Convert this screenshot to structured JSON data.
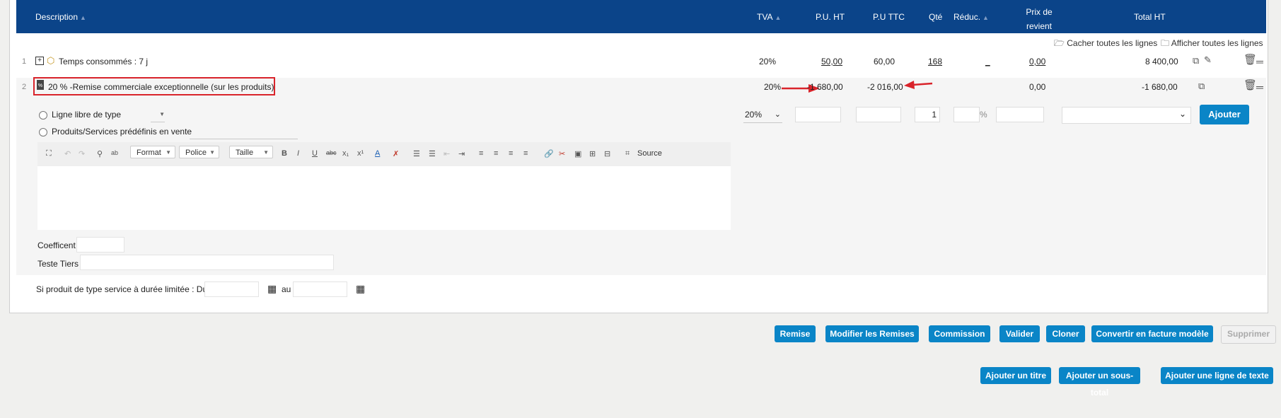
{
  "header": {
    "description": "Description",
    "tva": "TVA",
    "pu_ht": "P.U. HT",
    "pu_ttc": "P.U TTC",
    "qte": "Qté",
    "reduc": "Réduc.",
    "prix_revient_1": "Prix de",
    "prix_revient_2": "revient",
    "total_ht": "Total HT"
  },
  "toggles": {
    "hide_all": "Cacher toutes les lignes",
    "show_all": "Afficher toutes les lignes"
  },
  "lines": [
    {
      "num": "1",
      "label": "Temps consommés : 7 j",
      "tva": "20%",
      "pu_ht": "50,00",
      "pu_ttc": "60,00",
      "qte": "168",
      "reduc": "_",
      "prix_revient": "0,00",
      "total_ht": "8 400,00"
    },
    {
      "num": "2",
      "label": "20 % -Remise commerciale exceptionnelle (sur les produits)",
      "tva": "20%",
      "pu_ht": "-1 680,00",
      "pu_ttc": "-2 016,00",
      "prix_revient": "0,00",
      "total_ht": "-1 680,00"
    }
  ],
  "form": {
    "radio_free": "Ligne libre de type",
    "radio_predef": "Produits/Services prédéfinis en vente",
    "tva_select": "20%",
    "qty_value": "1",
    "percent": "%",
    "add_button": "Ajouter",
    "coefficient_label": "Coefficent",
    "teste_tiers_label": "Teste Tiers",
    "service_dates_label": "Si produit de type service à durée limitée : Du",
    "au_label": "au"
  },
  "editor": {
    "format": "Format",
    "police": "Police",
    "taille": "Taille",
    "source": "Source"
  },
  "actions": {
    "remise": "Remise",
    "modifier_remises": "Modifier les Remises",
    "commission": "Commission",
    "valider": "Valider",
    "cloner": "Cloner",
    "convertir": "Convertir en facture modèle",
    "supprimer": "Supprimer",
    "ajouter_titre": "Ajouter un titre",
    "ajouter_sous_total": "Ajouter un sous-total",
    "ajouter_ligne_texte": "Ajouter une ligne de texte"
  },
  "colors": {
    "header_bg": "#0b4489",
    "button_bg": "#0a85c7",
    "highlight_red": "#d9242b"
  }
}
